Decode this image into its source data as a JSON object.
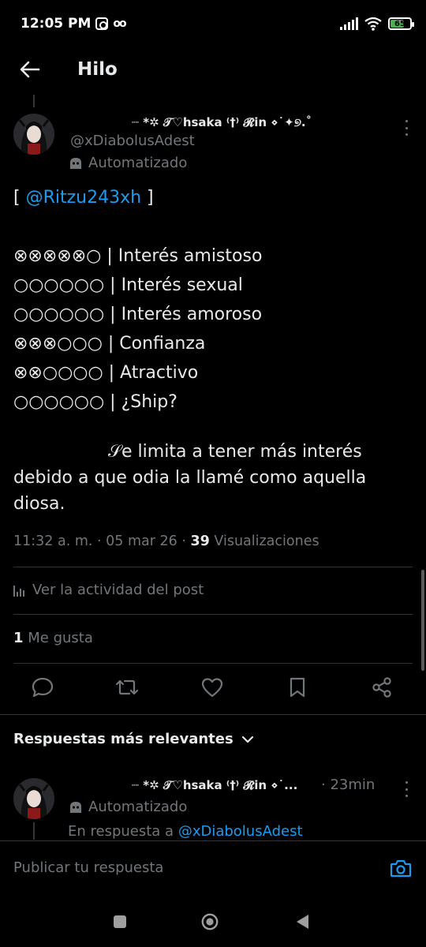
{
  "status_bar": {
    "time": "12:05 PM",
    "battery": "65",
    "battery_level": 0.65
  },
  "header": {
    "title": "Hilo"
  },
  "post": {
    "display_name": "┈ *✲ 𝒯♡hsaka ⁽†⁾ 𝓡in ⋄˙✦୭.˚",
    "handle": "@xDiabolusAdest",
    "automated_label": "Automatizado",
    "lines": [
      {
        "prefix": "[ ",
        "mention": "@Ritzu243xh",
        "suffix": " ]"
      }
    ],
    "stats": [
      "⊗⊗⊗⊗⊗○ | Interés amistoso",
      "○○○○○○ | Interés sexual",
      "○○○○○○ | Interés amoroso",
      "⊗⊗⊗○○○ | Confianza",
      "⊗⊗○○○○ |  Atractivo",
      "○○○○○○ | ¿Ship?"
    ],
    "body_text": "𝒮e limita a tener más interés debido a que odia la llamé como aquella diosa.",
    "meta_time": "11:32 a. m. · 05 mar 26 · ",
    "views_count": "39",
    "views_label": " Visualizaciones",
    "activity_label": "Ver la actividad del post",
    "likes_count": "1",
    "likes_label": " Me gusta"
  },
  "replies": {
    "header_label": "Respuestas más relevantes",
    "items": [
      {
        "display_name": "┈ *✲ 𝒯♡hsaka ⁽†⁾ 𝓡in ⋄˙...",
        "time": "· 23min",
        "automated_label": "Automatizado",
        "reply_to_prefix": "En respuesta a ",
        "reply_to_handle": "@xDiabolusAdest"
      }
    ]
  },
  "compose": {
    "placeholder": "Publicar tu respuesta"
  },
  "colors": {
    "accent": "#1d9bf0",
    "muted": "#71767b",
    "text": "#e7e9ea",
    "background": "#000000"
  }
}
